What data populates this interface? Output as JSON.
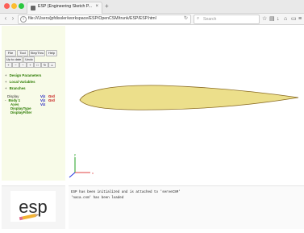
{
  "browser": {
    "tab_title": "ESP (Engineering Sketch P...",
    "tab_close": "×",
    "new_tab": "+",
    "url": "file:///Users/jpfdissler/workspace/ESP/OpenCSM/trunk/ESP/ESP.html",
    "search_placeholder": "Search",
    "reload_icon": "reload-icon",
    "toolbar_icons": [
      "star-icon",
      "reading-list-icon",
      "download-icon",
      "home-icon",
      "chat-icon",
      "menu-icon"
    ]
  },
  "toolbar": {
    "file_label": "File",
    "tool_label": "Tool",
    "step_thru_label": "StepThru",
    "help_label": "Help",
    "up_to_date_label": "Up to date",
    "undo_label": "Undo",
    "view_buttons": [
      "+",
      "−",
      "−",
      "+",
      "□",
      "↻",
      "⊥"
    ]
  },
  "tree": {
    "design_parameters": "Design Parameters",
    "local_variables": "Local Variables",
    "branches": "Branches",
    "display": "Display",
    "body_1": "Body 1",
    "axes": "Axes",
    "display_type": "DisplayType",
    "display_filter": "DisplayFilter",
    "viz_col": [
      "Viz",
      "Viz",
      "Viz"
    ],
    "grd_col": [
      "Grd",
      "Grd"
    ]
  },
  "colors": {
    "airfoil_fill": "#ecdf8b",
    "airfoil_edge": "#8a6b22",
    "tree_green": "#2b7a00",
    "viz_blue": "#2020c0",
    "grd_red": "#c00000",
    "axis_x": "#e04040",
    "axis_y": "#20a020",
    "axis_z": "#2030e0"
  },
  "logo": {
    "text": "esp"
  },
  "messages": [
    "ESP has been initialized and is attached to 'serveCSM'",
    "'naca.csm' has been loaded"
  ]
}
